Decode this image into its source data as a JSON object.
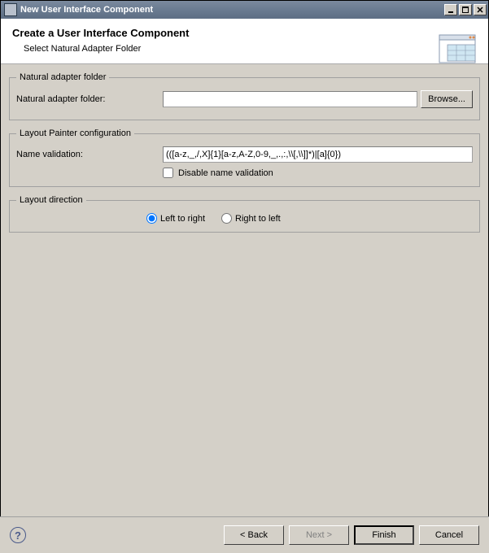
{
  "window": {
    "title": "New User Interface Component"
  },
  "header": {
    "title": "Create a User Interface Component",
    "subtitle": "Select Natural Adapter Folder"
  },
  "group_folder": {
    "legend": "Natural adapter folder",
    "label": "Natural adapter folder:",
    "value": "",
    "browse": "Browse..."
  },
  "group_layout": {
    "legend": "Layout Painter configuration",
    "label": "Name validation:",
    "value": "(([a-z,_,/,X]{1}[a-z,A-Z,0-9,_,.,:,\\\\[,\\\\]]*)|[a]{0})",
    "disable_label": "Disable name validation"
  },
  "group_direction": {
    "legend": "Layout direction",
    "ltr": "Left to right",
    "rtl": "Right to left"
  },
  "footer": {
    "back": "< Back",
    "next": "Next >",
    "finish": "Finish",
    "cancel": "Cancel"
  }
}
